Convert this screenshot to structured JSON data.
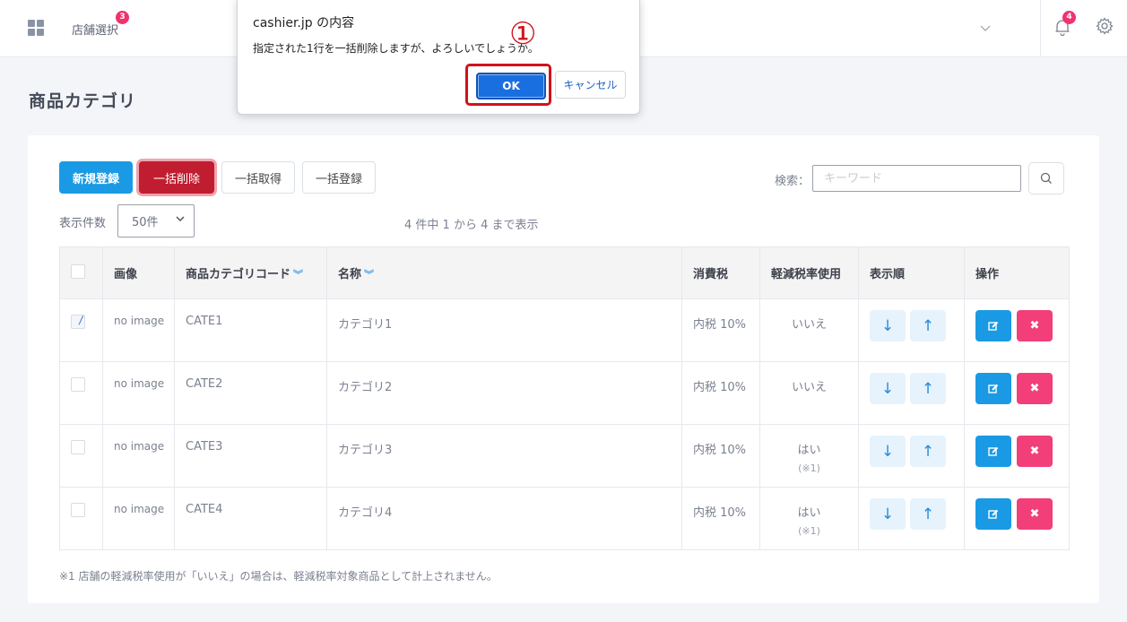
{
  "header": {
    "store_select_label": "店舗選択",
    "store_badge_count": "3",
    "notification_badge_count": "4",
    "dropdown_chevron": "⌵"
  },
  "page": {
    "title": "商品カテゴリ"
  },
  "toolbar": {
    "new_label": "新規登録",
    "bulk_delete_label": "一括削除",
    "bulk_get_label": "一括取得",
    "bulk_register_label": "一括登録",
    "search_label": "検索：",
    "search_placeholder": "キーワード",
    "search_value": "",
    "per_page_label": "表示件数",
    "per_page_value": "50件",
    "range_info": "4 件中 1 から 4 まで表示"
  },
  "table": {
    "columns": [
      "",
      "画像",
      "商品カテゴリコード",
      "名称",
      "消費税",
      "軽減税率使用",
      "表示順",
      "操作"
    ],
    "sortable_marker": "≫",
    "rows": [
      {
        "checked": true,
        "image": "no image",
        "code": "CATE1",
        "name": "カテゴリ1",
        "tax": "内税 10%",
        "reduced": "いいえ",
        "reduced_note": ""
      },
      {
        "checked": false,
        "image": "no image",
        "code": "CATE2",
        "name": "カテゴリ2",
        "tax": "内税 10%",
        "reduced": "いいえ",
        "reduced_note": ""
      },
      {
        "checked": false,
        "image": "no image",
        "code": "CATE3",
        "name": "カテゴリ3",
        "tax": "内税 10%",
        "reduced": "はい",
        "reduced_note": "(※1)"
      },
      {
        "checked": false,
        "image": "no image",
        "code": "CATE4",
        "name": "カテゴリ4",
        "tax": "内税 10%",
        "reduced": "はい",
        "reduced_note": "(※1)"
      }
    ],
    "order_down": "↓",
    "order_up": "↑",
    "delete_glyph": "✖"
  },
  "footnote": "※1 店舗の軽減税率使用が「いいえ」の場合は、軽減税率対象商品として計上されません。",
  "dialog": {
    "title": "cashier.jp の内容",
    "message": "指定された1行を一括削除しますが、よろしいでしょうか。",
    "ok_label": "OK",
    "cancel_label": "キャンセル",
    "step_marker": "①"
  },
  "colors": {
    "primary": "#1a9ae4",
    "danger": "#c11d30",
    "delete_pink": "#f23f7a",
    "badge": "#f0336d",
    "annotation_red": "#d0121c"
  }
}
